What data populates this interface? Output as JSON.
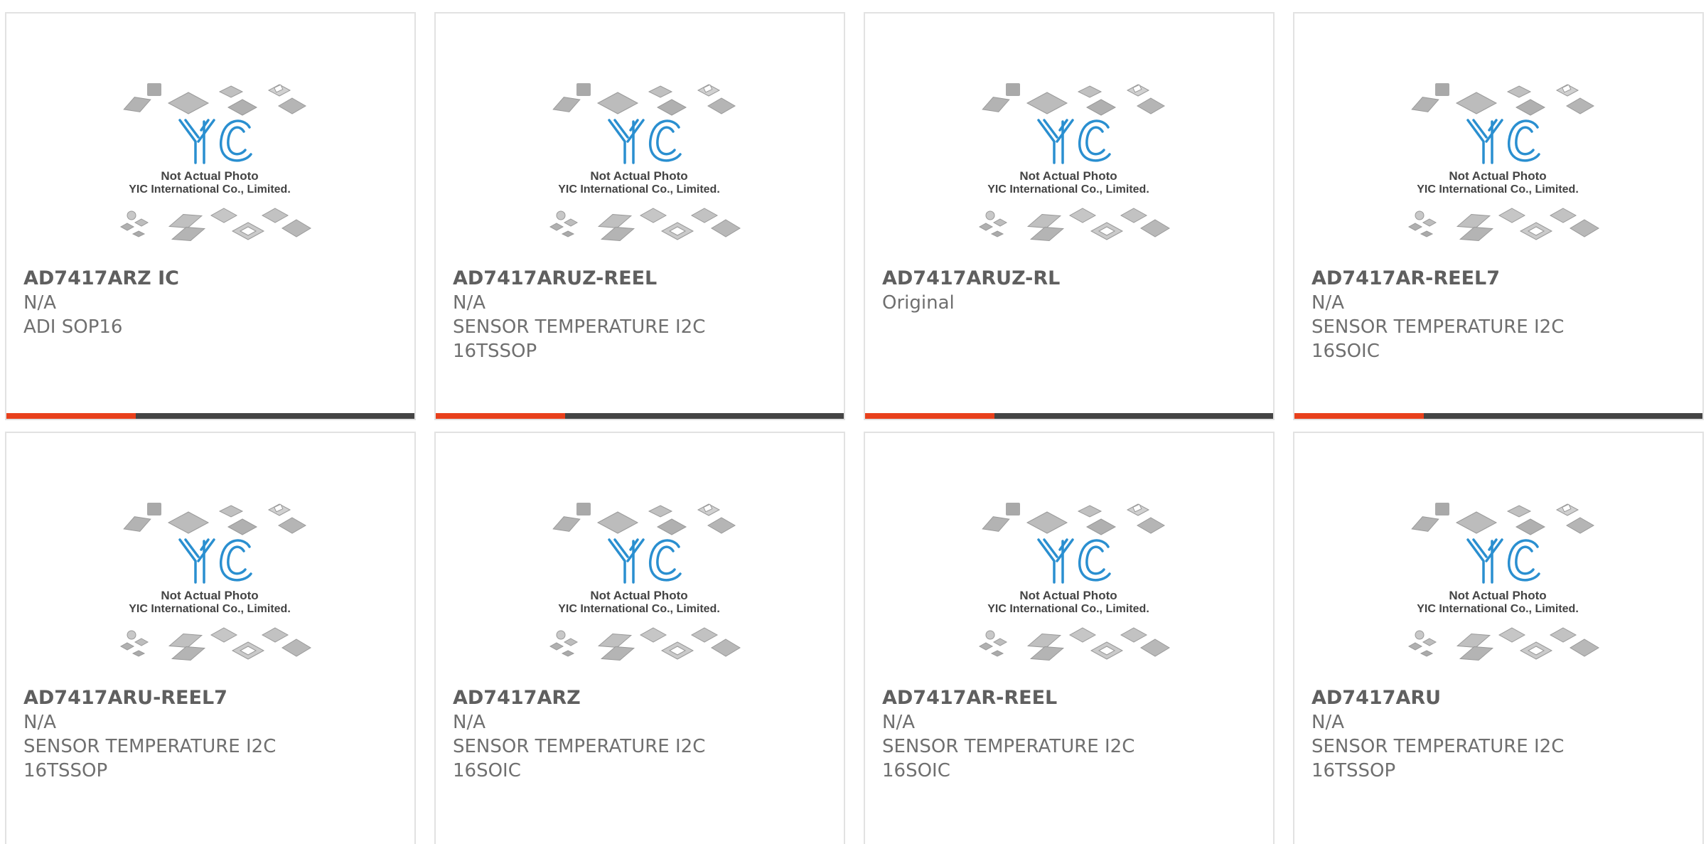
{
  "placeholder": {
    "line1": "Not Actual Photo",
    "line2": "YIC International Co., Limited.",
    "logo": "YIC"
  },
  "colors": {
    "accent": "#e8401c",
    "bar": "#444444",
    "logo": "#2a8fd0"
  },
  "products": [
    {
      "part": "AD7417ARZ IC",
      "lines": [
        "N/A",
        "ADI SOP16"
      ]
    },
    {
      "part": "AD7417ARUZ-REEL",
      "lines": [
        "N/A",
        "SENSOR TEMPERATURE I2C",
        "16TSSOP"
      ]
    },
    {
      "part": "AD7417ARUZ-RL",
      "lines": [
        "Original"
      ]
    },
    {
      "part": "AD7417AR-REEL7",
      "lines": [
        "N/A",
        "SENSOR TEMPERATURE I2C",
        "16SOIC"
      ]
    },
    {
      "part": "AD7417ARU-REEL7",
      "lines": [
        "N/A",
        "SENSOR TEMPERATURE I2C",
        "16TSSOP"
      ]
    },
    {
      "part": "AD7417ARZ",
      "lines": [
        "N/A",
        "SENSOR TEMPERATURE I2C",
        "16SOIC"
      ]
    },
    {
      "part": "AD7417AR-REEL",
      "lines": [
        "N/A",
        "SENSOR TEMPERATURE I2C",
        "16SOIC"
      ]
    },
    {
      "part": "AD7417ARU",
      "lines": [
        "N/A",
        "SENSOR TEMPERATURE I2C",
        "16TSSOP"
      ]
    }
  ]
}
